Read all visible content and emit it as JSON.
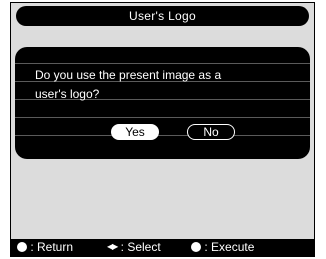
{
  "dialog_title": "User's Logo",
  "message_line1": "Do you use the present image as a",
  "message_line2": "user's logo?",
  "buttons": {
    "yes": "Yes",
    "no": "No"
  },
  "footer": {
    "return_label": ": Return",
    "select_label": ": Select",
    "execute_label": ": Execute",
    "icons": [
      "esc-button-icon",
      "left-right-arrows-icon",
      "enter-button-icon"
    ]
  },
  "colors": {
    "background": "#dcdcdc",
    "panel": "#000000",
    "text_light": "#ffffff"
  }
}
